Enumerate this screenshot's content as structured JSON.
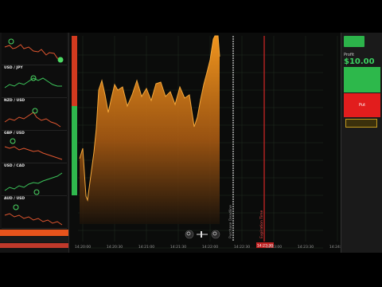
{
  "assets": [
    {
      "name": "",
      "pct": "",
      "color": "#e0562f"
    },
    {
      "name": "USD / JPY",
      "pct": "",
      "color": "#3cc45a"
    },
    {
      "name": "NZD / USD",
      "pct": "",
      "color": "#e0562f"
    },
    {
      "name": "GBP / USD",
      "pct": "",
      "color": "#e0562f"
    },
    {
      "name": "USD / CAD",
      "pct": "",
      "color": "#3cc45a"
    },
    {
      "name": "AUD / USD",
      "pct": "",
      "color": "#e0562f"
    }
  ],
  "asset_buttons": {
    "primary": "",
    "secondary": "",
    "tertiary": ""
  },
  "chart": {
    "x_ticks": [
      "14:20:00",
      "14:20:30",
      "14:21:00",
      "14:21:30",
      "14:22:00",
      "14:22:30",
      "14:23:00",
      "14:23:30",
      "14:24:00"
    ],
    "y_ticks": [
      "",
      "",
      "",
      "",
      "",
      "",
      "",
      "",
      "",
      "",
      "",
      ""
    ],
    "purchase_deadline_label": "Purchase Deadline",
    "expiry_label": "Expiration Time",
    "expiry_time": "14:23:30",
    "zoom": {
      "zoom_out": "zoom-out-icon",
      "zoom_in": "zoom-in-icon"
    },
    "colors": {
      "area": "#e8891a",
      "line": "#f0a030",
      "expiry": "#ff3030"
    }
  },
  "panel": {
    "tab": "",
    "payout_label": "Profit",
    "amount": "$10.00",
    "call_label": "",
    "put_label": "Put",
    "confirm_label": ""
  }
}
